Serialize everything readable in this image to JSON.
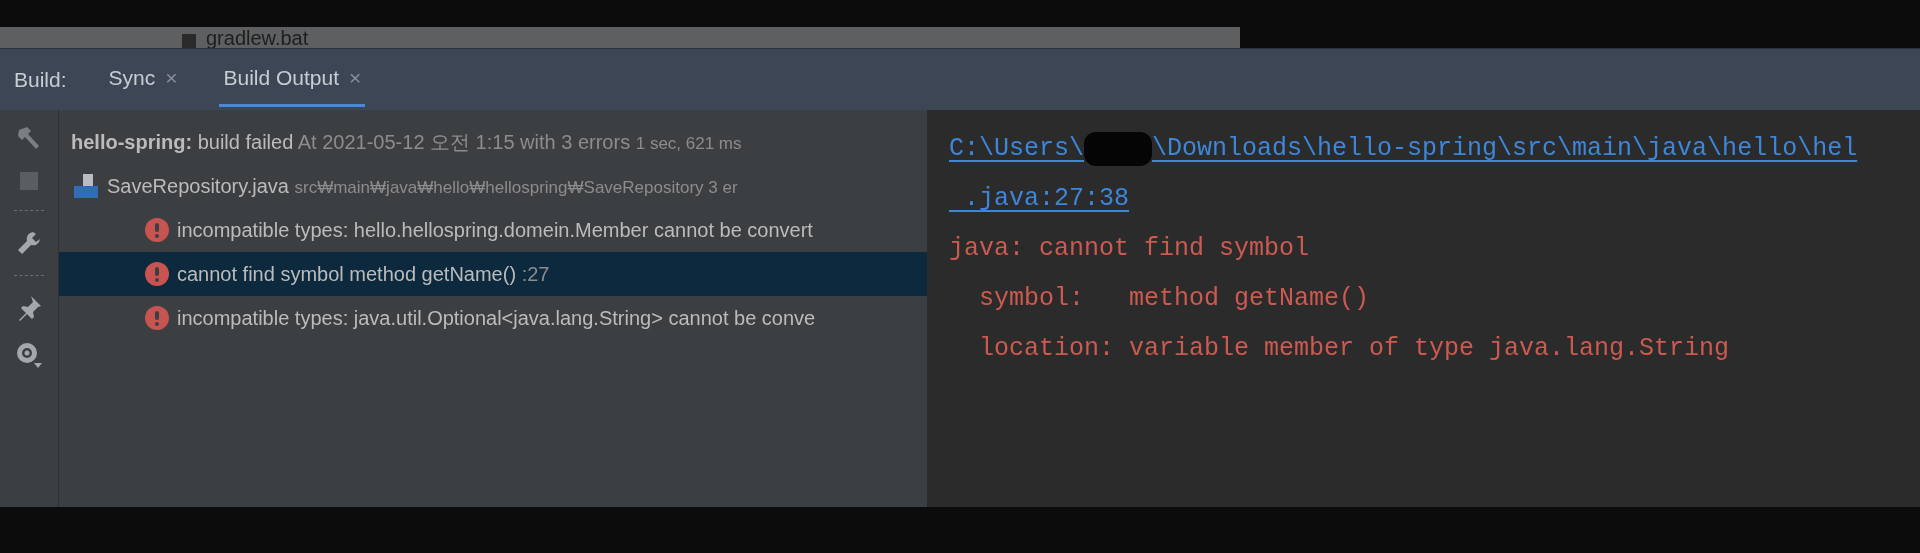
{
  "file_strip": {
    "file_name": "gradlew.bat"
  },
  "tabs_label": "Build:",
  "tabs": [
    {
      "label": "Sync",
      "close": "×",
      "selected": false
    },
    {
      "label": "Build Output",
      "close": "×",
      "selected": true
    }
  ],
  "tree": {
    "project": "hello-spring:",
    "status": "build failed",
    "detail": "At 2021-05-12 오전 1:15 with 3 errors",
    "duration": "1 sec, 621 ms",
    "children": [
      {
        "name": "SaveRepository.java",
        "path": "src₩main₩java₩hello₩hellospring₩SaveRepository 3 er",
        "children": [
          {
            "message": "incompatible types: hello.hellospring.domein.Member cannot be convert",
            "selected": false
          },
          {
            "message": "cannot find symbol method getName()",
            "line": ":27",
            "selected": true
          },
          {
            "message": "incompatible types: java.util.Optional<java.lang.String> cannot be conve",
            "selected": false
          }
        ]
      }
    ]
  },
  "console": {
    "link_start": "C:\\Users\\",
    "link_end": "\\Downloads\\hello-spring\\src\\main\\java\\hello\\hel",
    "link_cont": ".java:27:38",
    "lines": [
      "java: cannot find symbol",
      "  symbol:   method getName()",
      "  location: variable member of type java.lang.String"
    ]
  }
}
